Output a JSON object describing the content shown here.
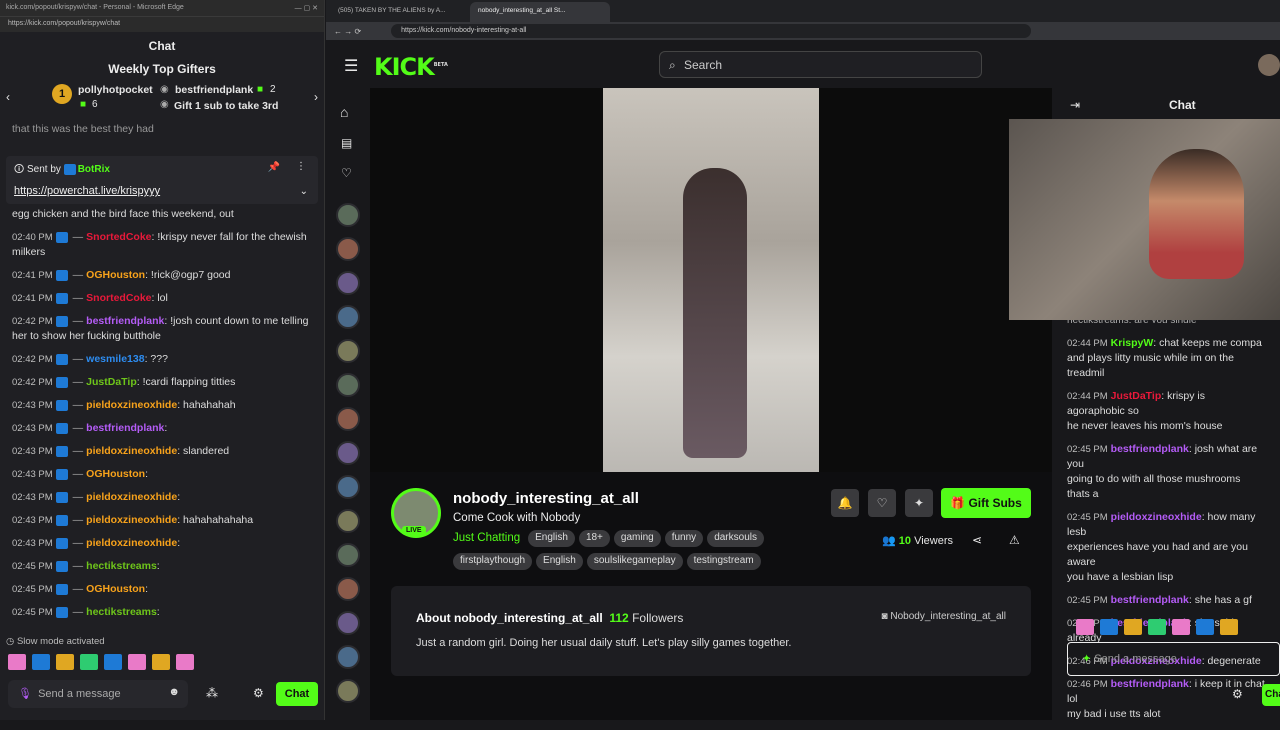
{
  "left_window": {
    "title_bar": "kick.com/popout/krispyw/chat - Personal - Microsoft Edge",
    "address": "https://kick.com/popout/krispyw/chat",
    "header": "Chat",
    "weekly_title": "Weekly Top Gifters",
    "gifter1": {
      "rank": "1",
      "name": "pollyhotpocket",
      "count": "6"
    },
    "gifter2": {
      "name": "bestfriendplank",
      "count": "2"
    },
    "gifter3_text": "Gift 1 sub to take 3rd",
    "cutoff": "that this was the best they had",
    "pinned": {
      "sent_by": "Sent by",
      "bot": "BotRix",
      "link": "https://powerchat.live/krispyyy"
    },
    "first_line": "egg chicken and the bird face this weekend, out",
    "messages": [
      {
        "t": "02:40 PM",
        "u": "SnortedCoke",
        "m": ": !krispy never fall for the chewish milkers"
      },
      {
        "t": "02:41 PM",
        "u": "OGHouston",
        "m": ": !rick@ogp7 good"
      },
      {
        "t": "02:41 PM",
        "u": "SnortedCoke",
        "m": ": lol"
      },
      {
        "t": "02:42 PM",
        "u": "bestfriendplank",
        "m": ": !josh count down to me telling her to show her fucking butthole"
      },
      {
        "t": "02:42 PM",
        "u": "wesmile138",
        "m": ": ???"
      },
      {
        "t": "02:42 PM",
        "u": "JustDaTip",
        "m": ": !cardi flapping titties"
      },
      {
        "t": "02:43 PM",
        "u": "pieldoxzineoxhide",
        "m": ": hahahahah"
      },
      {
        "t": "02:43 PM",
        "u": "bestfriendplank",
        "m": ":"
      },
      {
        "t": "02:43 PM",
        "u": "pieldoxzineoxhide",
        "m": ": slandered"
      },
      {
        "t": "02:43 PM",
        "u": "OGHouston",
        "m": ":"
      },
      {
        "t": "02:43 PM",
        "u": "pieldoxzineoxhide",
        "m": ":"
      },
      {
        "t": "02:43 PM",
        "u": "pieldoxzineoxhide",
        "m": ": hahahahahaha"
      },
      {
        "t": "02:43 PM",
        "u": "pieldoxzineoxhide",
        "m": ":"
      },
      {
        "t": "02:45 PM",
        "u": "hectikstreams",
        "m": ":"
      },
      {
        "t": "02:45 PM",
        "u": "OGHouston",
        "m": ":"
      },
      {
        "t": "02:45 PM",
        "u": "hectikstreams",
        "m": ":"
      }
    ],
    "slow_mode": "Slow mode activated",
    "send_placeholder": "Send a message",
    "chat_button": "Chat"
  },
  "main": {
    "tab1": "(505) TAKEN BY THE ALIENS by A...",
    "tab2": "nobody_interesting_at_all St...",
    "url": "https://kick.com/nobody-interesting-at-all",
    "logo": "KICK",
    "beta": "BETA",
    "search": "Search",
    "channel": {
      "name": "nobody_interesting_at_all",
      "title": "Come Cook with Nobody",
      "category": "Just Chatting",
      "live": "LIVE",
      "tags1": [
        "English",
        "18+",
        "gaming",
        "funny",
        "darksouls"
      ],
      "tags2": [
        "firstplaythough",
        "English",
        "soulslikegameplay",
        "testingstream"
      ],
      "gift": "Gift Subs",
      "viewers": "10",
      "viewers_label": "Viewers"
    },
    "about": {
      "title": "About nobody_interesting_at_all",
      "followers": "112",
      "followers_label": "Followers",
      "handle": "Nobody_interesting_at_all",
      "bio": "Just a random girl. Doing her usual daily stuff. Let's play silly games together."
    },
    "chat": {
      "header": "Chat",
      "messages": [
        {
          "t": "02:44 PM",
          "u": "KrispyW",
          "m": ": chat keeps me compa",
          "m2": "and plays litty music while im on the treadmil"
        },
        {
          "t": "02:44 PM",
          "u": "JustDaTip",
          "m": ": krispy is agoraphobic so",
          "m2": "he never leaves his mom's house"
        },
        {
          "t": "02:45 PM",
          "u": "bestfriendplank",
          "m": ": josh what are you",
          "m2": "going to do with all those mushrooms thats a"
        },
        {
          "t": "02:45 PM",
          "u": "pieldoxzineoxhide",
          "m": ": how many lesb",
          "m2": "experiences have you had and are you aware",
          "m3": "you have a lesbian lisp"
        },
        {
          "t": "02:45 PM",
          "u": "bestfriendplank",
          "m": ": she has a gf"
        },
        {
          "t": "02:45 PM",
          "u": "bestfriendplank",
          "m": ": she said already"
        },
        {
          "t": "02:46 PM",
          "u": "pieldoxzineoxhide",
          "m": ": degenerate"
        },
        {
          "t": "02:46 PM",
          "u": "bestfriendplank",
          "m": ": i keep it in chat lol",
          "m2": "my bad i use tts alot"
        }
      ],
      "partial_top": "hectikstreams: are you single",
      "send_placeholder": "Send a message",
      "chat_button": "Chat"
    }
  }
}
